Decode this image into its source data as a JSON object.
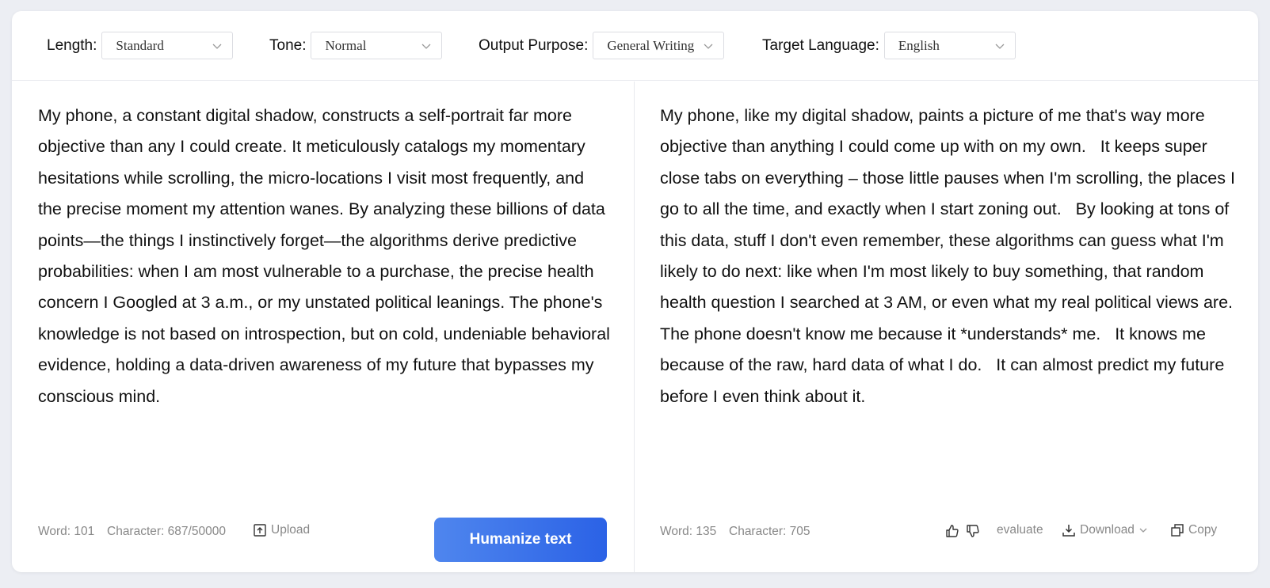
{
  "toolbar": {
    "length": {
      "label": "Length:",
      "value": "Standard"
    },
    "tone": {
      "label": "Tone:",
      "value": "Normal"
    },
    "purpose": {
      "label": "Output Purpose:",
      "value": "General Writing"
    },
    "language": {
      "label": "Target Language:",
      "value": "English"
    }
  },
  "input": {
    "text": "My phone, a constant digital shadow, constructs a self-portrait far more objective than any I could create. It meticulously catalogs my momentary hesitations while scrolling, the micro-locations I visit most frequently, and the precise moment my attention wanes. By analyzing these billions of data points—the things I instinctively forget—the algorithms derive predictive probabilities: when I am most vulnerable to a purchase, the precise health concern I Googled at 3 a.m., or my unstated political leanings. The phone's knowledge is not based on introspection, but on cold, undeniable behavioral evidence, holding a data-driven awareness of my future that bypasses my conscious mind.",
    "word_count": "Word: 101",
    "char_count": "Character: 687/50000",
    "upload_label": "Upload",
    "humanize_label": "Humanize text"
  },
  "output": {
    "text": "My phone, like my digital shadow, paints a picture of me that's way more objective than anything I could come up with on my own.   It keeps super close tabs on everything – those little pauses when I'm scrolling, the places I go to all the time, and exactly when I start zoning out.   By looking at tons of this data, stuff I don't even remember, these algorithms can guess what I'm likely to do next: like when I'm most likely to buy something, that random health question I searched at 3 AM, or even what my real political views are.   The phone doesn't know me because it *understands* me.   It knows me because of the raw, hard data of what I do.   It can almost predict my future before I even think about it.",
    "word_count": "Word: 135",
    "char_count": "Character: 705",
    "evaluate_label": "evaluate",
    "download_label": "Download",
    "copy_label": "Copy"
  },
  "colors": {
    "accent_start": "#4f86ee",
    "accent_end": "#2b62e6",
    "muted_text": "#888888",
    "background": "#eceef3"
  }
}
